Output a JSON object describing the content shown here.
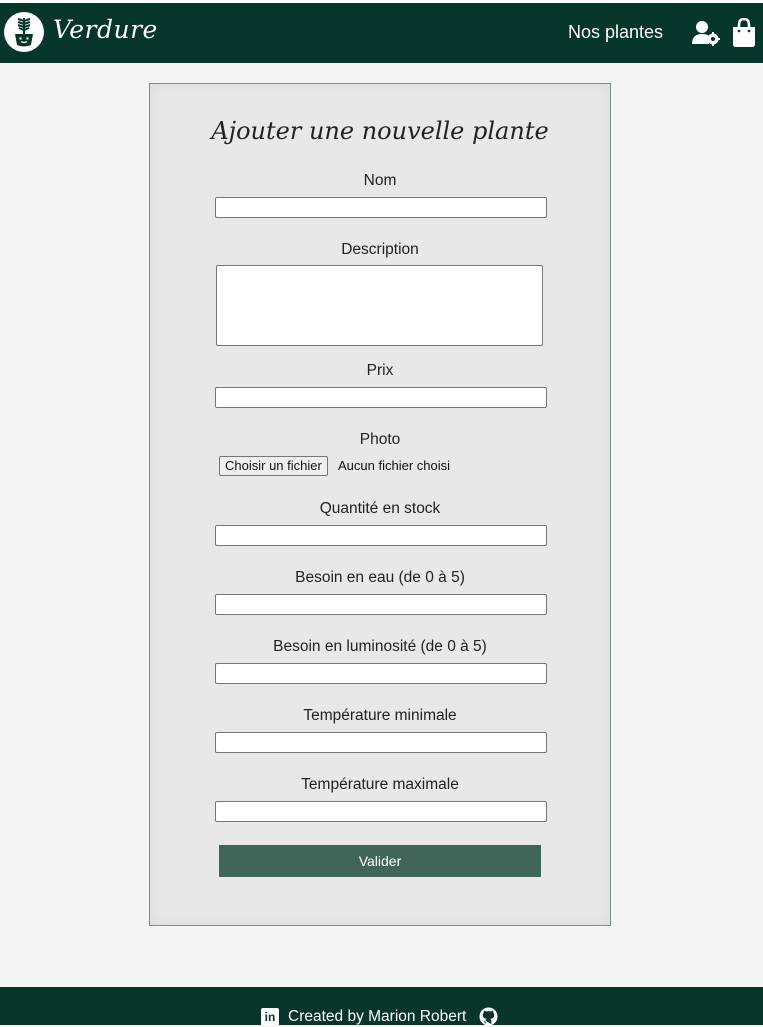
{
  "header": {
    "brand": "Verdure",
    "nav_link": "Nos plantes",
    "icons": [
      "plant-logo-icon",
      "user-settings-icon",
      "shopping-bag-icon"
    ]
  },
  "form": {
    "title": "Ajouter une nouvelle plante",
    "fields": {
      "name": {
        "label": "Nom",
        "value": ""
      },
      "description": {
        "label": "Description",
        "value": ""
      },
      "price": {
        "label": "Prix",
        "value": ""
      },
      "photo": {
        "label": "Photo",
        "button": "Choisir un fichier",
        "status": "Aucun fichier choisi"
      },
      "stock": {
        "label": "Quantité en stock",
        "value": ""
      },
      "water": {
        "label": "Besoin en eau (de 0 à 5)",
        "value": ""
      },
      "light": {
        "label": "Besoin en luminosité (de 0 à 5)",
        "value": ""
      },
      "temp_min": {
        "label": "Température minimale",
        "value": ""
      },
      "temp_max": {
        "label": "Température maximale",
        "value": ""
      }
    },
    "submit_label": "Valider"
  },
  "footer": {
    "text": "Created by Marion Robert",
    "icons": [
      "linkedin-icon",
      "github-icon"
    ]
  },
  "colors": {
    "header_bg": "#06352a",
    "page_bg": "#f4f4f4",
    "card_bg": "#e8e8e8",
    "button_bg": "#3f6659"
  }
}
